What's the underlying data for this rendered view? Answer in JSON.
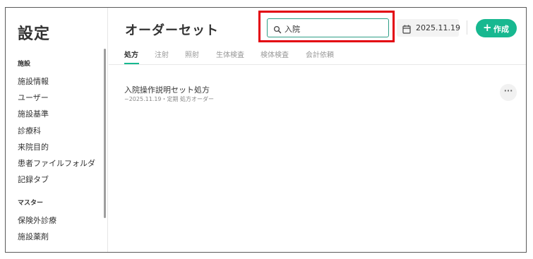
{
  "app": {
    "title": "設定"
  },
  "sidebar": {
    "sections": [
      {
        "label": "施設",
        "items": [
          "施設情報",
          "ユーザー",
          "施設基準",
          "診療科",
          "来院目的",
          "患者ファイルフォルダ",
          "記録タブ"
        ]
      },
      {
        "label": "マスター",
        "items": [
          "保険外診療",
          "施設薬剤"
        ]
      }
    ]
  },
  "header": {
    "title": "オーダーセット",
    "search": {
      "value": "入院",
      "icon": "search-icon"
    },
    "date": {
      "value": "2025.11.19",
      "icon": "calendar-icon"
    },
    "create_label": "作成",
    "create_icon": "+"
  },
  "tabs": [
    "処方",
    "注射",
    "照射",
    "生体検査",
    "検体検査",
    "会計依頼"
  ],
  "list": [
    {
      "title": "入院操作説明セット処方",
      "subtitle": "~2025.11.19・定期 処方オーダー",
      "more": "···"
    }
  ],
  "colors": {
    "accent": "#17b890",
    "highlight": "#e3000f",
    "search_border": "#2e9e86"
  }
}
